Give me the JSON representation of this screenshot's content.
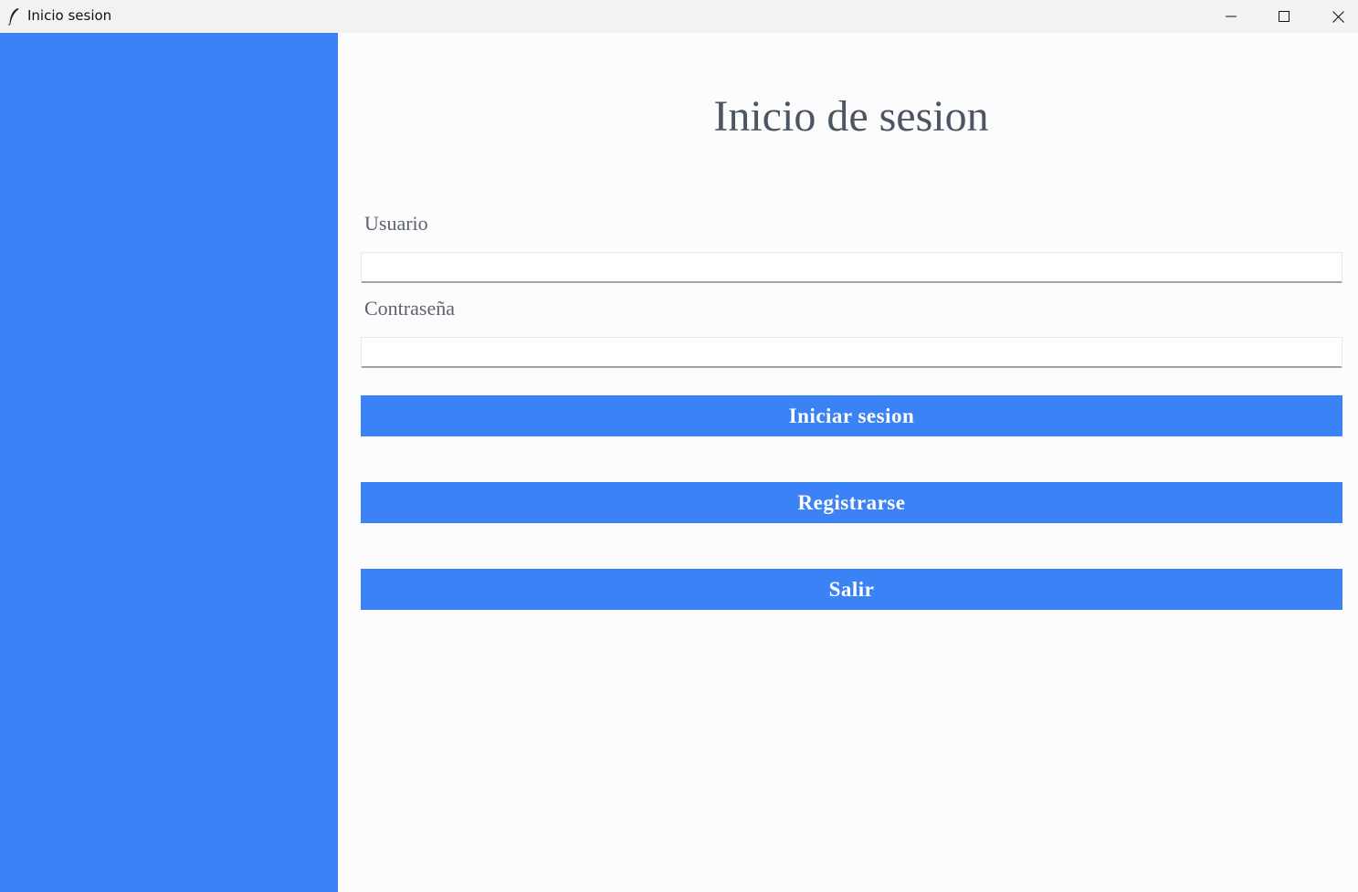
{
  "window": {
    "title": "Inicio sesion",
    "icon": "feather-icon",
    "controls": [
      "minimize-icon",
      "maximize-icon",
      "close-icon"
    ]
  },
  "colors": {
    "accent": "#3b82f6",
    "background": "#fcfcfc",
    "title_text": "#4b5563"
  },
  "form": {
    "title": "Inicio de sesion",
    "username_label": "Usuario",
    "username_value": "",
    "password_label": "Contraseña",
    "password_value": "",
    "login_button": "Iniciar sesion",
    "register_button": "Registrarse",
    "exit_button": "Salir"
  }
}
